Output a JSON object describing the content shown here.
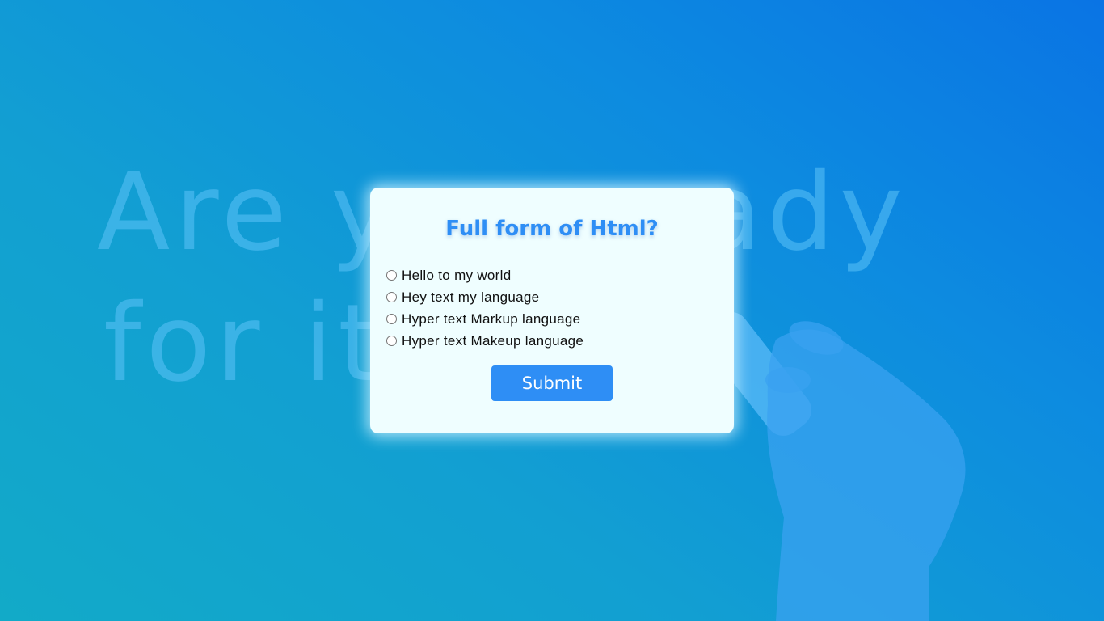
{
  "background": {
    "chalk_line1": "Are you ready",
    "chalk_line2": "for it"
  },
  "quiz": {
    "title": "Full form of Html?",
    "options": [
      "Hello to my world",
      "Hey text my language",
      "Hyper text Markup language",
      "Hyper text Makeup language"
    ],
    "submit_label": "Submit"
  },
  "colors": {
    "accent": "#2e8ef5",
    "card_bg": "#effeff"
  }
}
